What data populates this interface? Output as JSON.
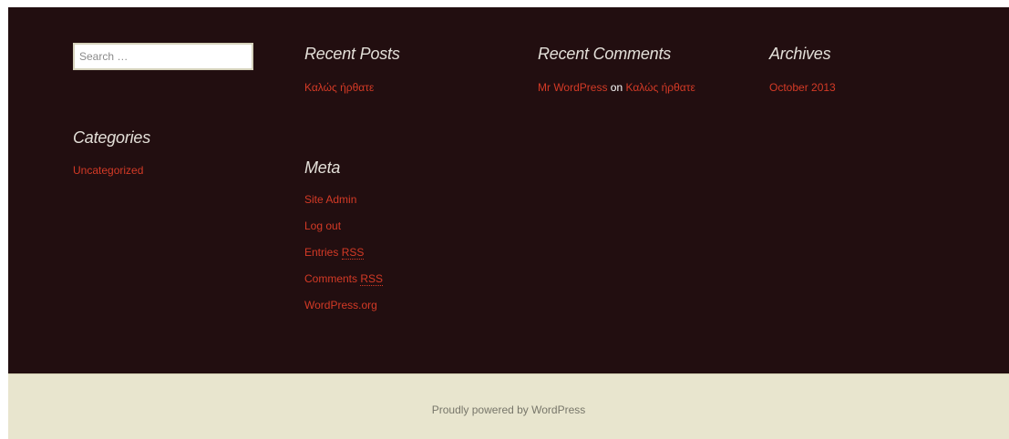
{
  "search": {
    "placeholder": "Search …"
  },
  "recent_posts": {
    "title": "Recent Posts",
    "items": [
      {
        "label": "Καλώς ήρθατε"
      }
    ]
  },
  "recent_comments": {
    "title": "Recent Comments",
    "items": [
      {
        "author": "Mr WordPress",
        "connector": "on",
        "post": "Καλώς ήρθατε"
      }
    ]
  },
  "archives": {
    "title": "Archives",
    "items": [
      {
        "label": "October 2013"
      }
    ]
  },
  "categories": {
    "title": "Categories",
    "items": [
      {
        "label": "Uncategorized"
      }
    ]
  },
  "meta": {
    "title": "Meta",
    "items": [
      {
        "label": "Site Admin"
      },
      {
        "label": "Log out"
      },
      {
        "label": "Entries ",
        "abbr": "RSS"
      },
      {
        "label": "Comments ",
        "abbr": "RSS"
      },
      {
        "label": "WordPress.org"
      }
    ]
  },
  "footer": {
    "credit": "Proudly powered by WordPress"
  },
  "colors": {
    "widgets_background": "#220e10",
    "footer_background": "#e8e5ce",
    "link": "#d43a26",
    "heading": "#e3dfd8"
  }
}
